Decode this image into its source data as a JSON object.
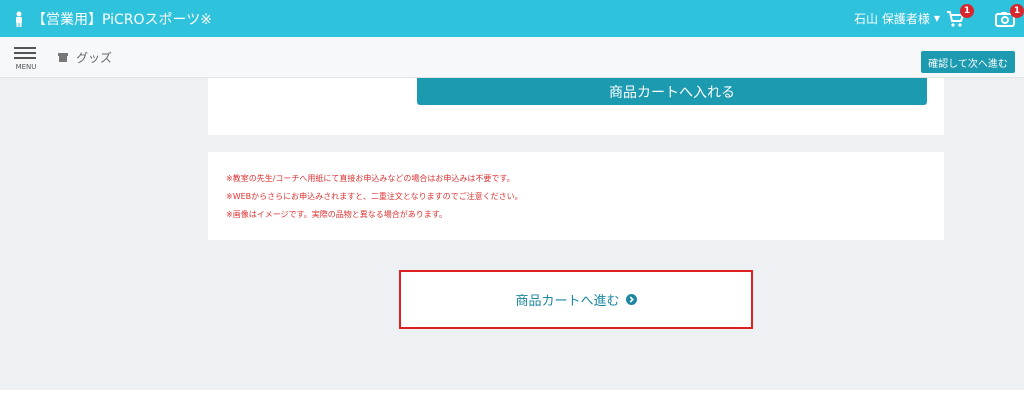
{
  "header": {
    "title": "【営業用】PiCROスポーツ※",
    "user": "石山 保護者様",
    "cart_badge": "1",
    "camera_badge": "1",
    "person_icon": "person-icon",
    "cart_icon": "cart-icon",
    "camera_icon": "camera-icon"
  },
  "subbar": {
    "menu_label": "MENU",
    "breadcrumb": "グッズ",
    "next_button": "確認して次へ進む"
  },
  "main": {
    "add_to_cart": "商品カートへ入れる",
    "notes": [
      "※教室の先生/コーチへ用紙にて直接お申込みなどの場合はお申込みは不要です。",
      "※WEBからさらにお申込みされますと、二重注文となりますのでご注意ください。",
      "※画像はイメージです。実際の品物と異なる場合があります。"
    ],
    "proceed_button": "商品カートへ進む"
  },
  "colors": {
    "header_bg": "#2ec2dc",
    "button_bg": "#1b9ab0",
    "note_text": "#dd3333",
    "highlight_border": "#e02020"
  }
}
